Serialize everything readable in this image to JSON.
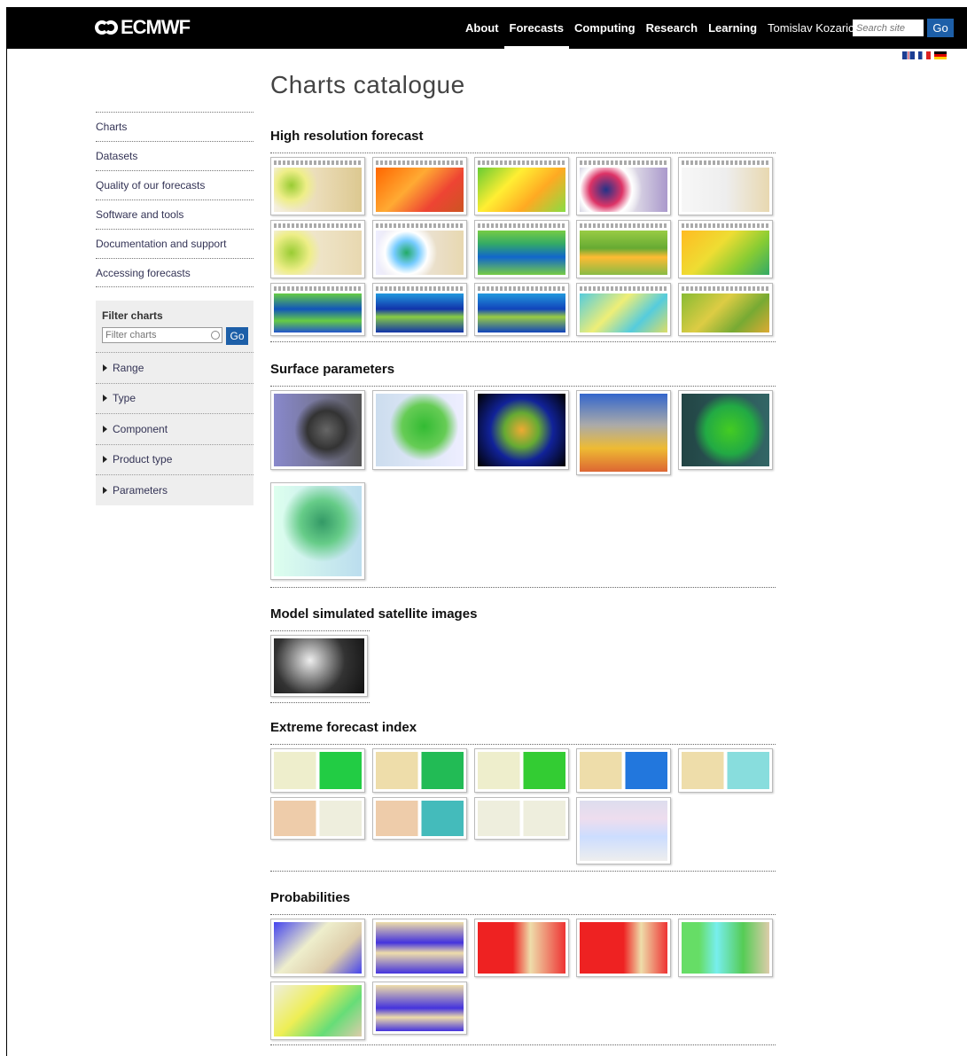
{
  "header": {
    "logo_text": "ECMWF",
    "nav": [
      "About",
      "Forecasts",
      "Computing",
      "Research",
      "Learning"
    ],
    "active_nav": "Forecasts",
    "user": "Tomislav Kozaric",
    "search_placeholder": "Search site",
    "search_button": "Go"
  },
  "languages": [
    "uk-flag",
    "fr-flag",
    "de-flag"
  ],
  "page_title": "Charts catalogue",
  "sidebar": {
    "links": [
      "Charts",
      "Datasets",
      "Quality of our forecasts",
      "Software and tools",
      "Documentation and support",
      "Accessing forecasts"
    ],
    "filter": {
      "title": "Filter charts",
      "placeholder": "Filter charts",
      "button": "Go",
      "facets": [
        "Range",
        "Type",
        "Component",
        "Product type",
        "Parameters"
      ]
    }
  },
  "sections": [
    {
      "title": "High resolution forecast",
      "count": 15
    },
    {
      "title": "Surface parameters",
      "count": 6
    },
    {
      "title": "Model simulated satellite images",
      "count": 1
    },
    {
      "title": "Extreme forecast index",
      "count": 9
    },
    {
      "title": "Probabilities",
      "count": 7
    }
  ],
  "colors": {
    "header_bg": "#000000",
    "button_blue": "#1d5fa8"
  }
}
